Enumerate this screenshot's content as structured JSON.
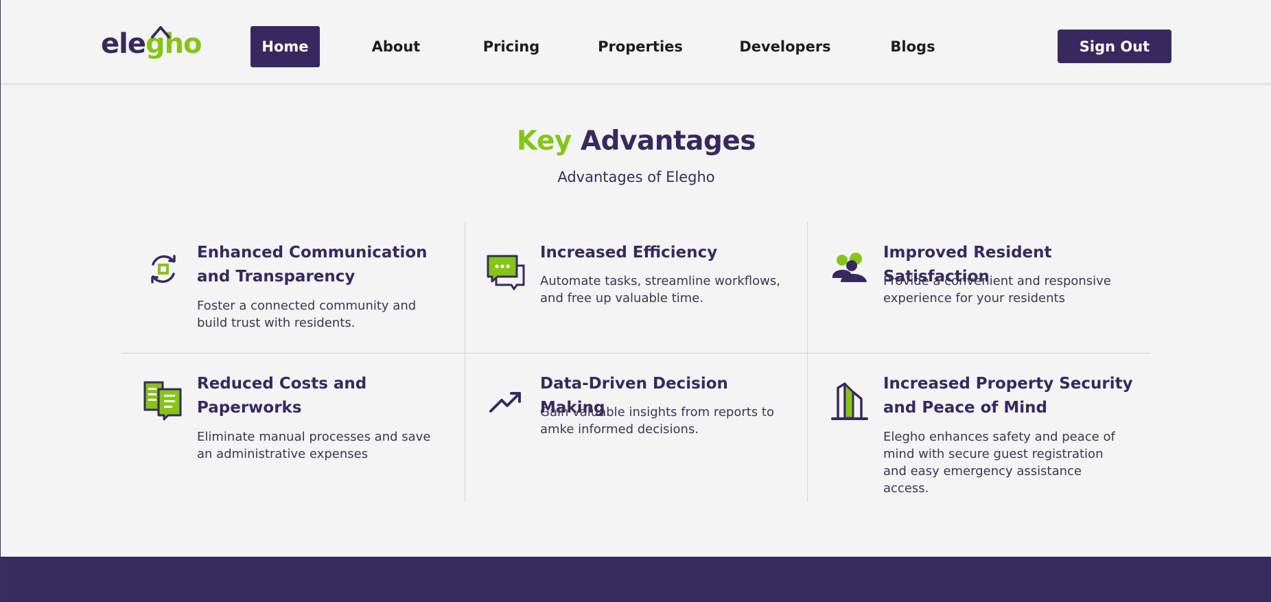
{
  "brand": {
    "logo_main": "ele",
    "logo_g": "gh",
    "logo_o": "o",
    "primary_color": "#37295f",
    "accent_color": "#86c516"
  },
  "nav": {
    "items": [
      {
        "label": "Home",
        "active": true
      },
      {
        "label": "About"
      },
      {
        "label": "Pricing"
      },
      {
        "label": "Properties"
      },
      {
        "label": "Developers"
      },
      {
        "label": "Blogs"
      }
    ],
    "signout_label": "Sign Out"
  },
  "section": {
    "title_accent": "Key",
    "title_rest": "Advantages",
    "subtitle": "Advantages of Elegho"
  },
  "cards": [
    {
      "icon": "refresh-cycle-icon",
      "title": "Enhanced Communication and Transparency",
      "desc": "Foster a connected community and build trust with residents."
    },
    {
      "icon": "chat-bubbles-icon",
      "title": "Increased Efficiency",
      "desc": "Automate tasks, streamline workflows, and free up valuable time."
    },
    {
      "icon": "users-icon",
      "title": "Improved Resident Satisfaction",
      "desc": "Provide a convenient and responsive experience for your residents"
    },
    {
      "icon": "documents-icon",
      "title": "Reduced Costs and Paperworks",
      "desc": "Eliminate manual processes and save an administrative expenses"
    },
    {
      "icon": "trending-up-icon",
      "title": "Data-Driven Decision Making",
      "desc": "Gain valuable insights from reports to amke informed decisions."
    },
    {
      "icon": "building-icon",
      "title": "Increased Property Security and Peace of Mind",
      "desc": "Elegho enhances safety and peace of mind with secure guest registration and easy emergency assistance access."
    }
  ]
}
